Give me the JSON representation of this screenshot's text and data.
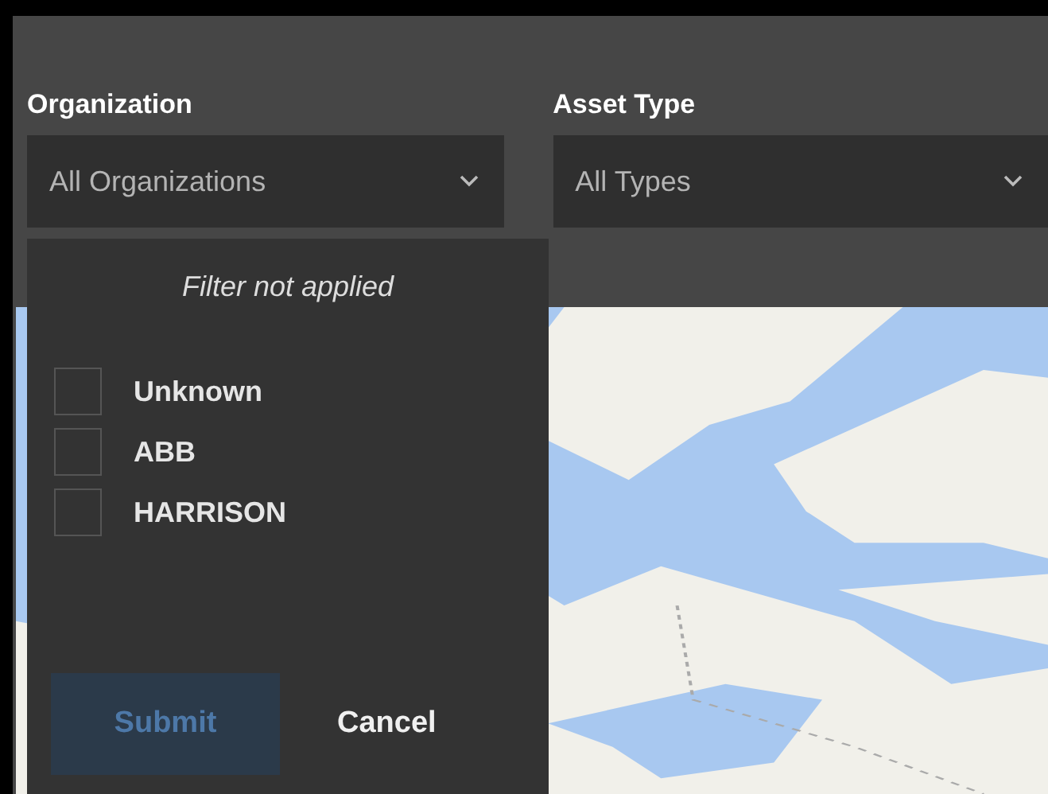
{
  "filters": [
    {
      "label": "Organization",
      "value": "All Organizations",
      "dropdown": {
        "status": "Filter not applied",
        "options": [
          {
            "label": "Unknown",
            "checked": false
          },
          {
            "label": "ABB",
            "checked": false
          },
          {
            "label": "HARRISON",
            "checked": false
          }
        ],
        "buttons": [
          {
            "label": "Submit",
            "kind": "primary",
            "disabled": true
          },
          {
            "label": "Cancel",
            "kind": "plain",
            "disabled": false
          }
        ]
      }
    },
    {
      "label": "Asset Type",
      "value": "All Types"
    }
  ]
}
